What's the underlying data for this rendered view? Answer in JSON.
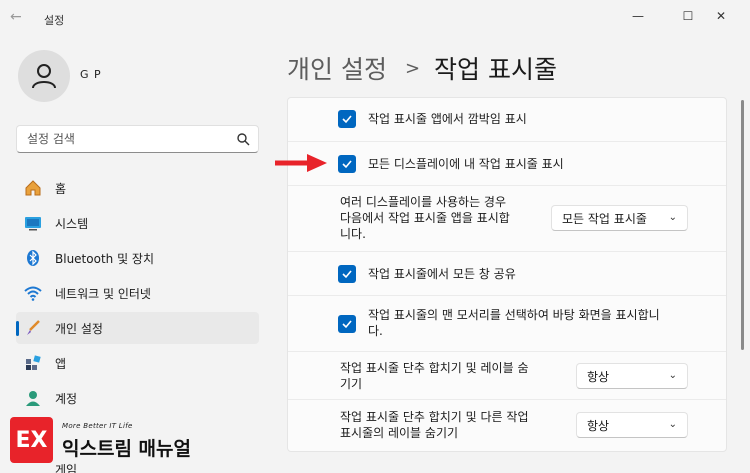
{
  "window": {
    "title": "설정",
    "back": "←",
    "minimize": "—",
    "maximize": "☐",
    "close": "✕"
  },
  "profile": {
    "name": "G P"
  },
  "search": {
    "placeholder": "설정 검색"
  },
  "nav": {
    "items": [
      {
        "label": "홈",
        "icon": "home-icon"
      },
      {
        "label": "시스템",
        "icon": "system-icon"
      },
      {
        "label": "Bluetooth 및 장치",
        "icon": "bluetooth-icon"
      },
      {
        "label": "네트워크 및 인터넷",
        "icon": "wifi-icon"
      },
      {
        "label": "개인 설정",
        "icon": "brush-icon",
        "selected": true
      },
      {
        "label": "앱",
        "icon": "apps-icon"
      },
      {
        "label": "계정",
        "icon": "account-icon"
      }
    ],
    "partial_item": "게임"
  },
  "breadcrumb": {
    "parent": "개인 설정",
    "separator": ">",
    "current": "작업 표시줄"
  },
  "settings": {
    "flash_apps": {
      "label": "작업 표시줄 앱에서 깜박임 표시",
      "checked": true
    },
    "all_displays": {
      "label": "모든 디스플레이에 내 작업 표시줄 표시",
      "checked": true
    },
    "multi_display": {
      "label_line1": "여러 디스플레이를 사용하는 경우",
      "label_line2": "다음에서 작업 표시줄 앱을 표시합",
      "label_line3": "니다.",
      "value": "모든 작업 표시줄"
    },
    "share_windows": {
      "label": "작업 표시줄에서 모든 창 공유",
      "checked": true
    },
    "corner_desktop": {
      "label_line1": "작업 표시줄의 맨 모서리를 선택하여 바탕 화면을 표시합니",
      "label_line2": "다.",
      "checked": true
    },
    "combine_main": {
      "label_line1": "작업 표시줄 단추 합치기 및 레이블 숨",
      "label_line2": "기기",
      "value": "항상"
    },
    "combine_other": {
      "label_line1": "작업 표시줄 단추 합치기 및 다른 작업",
      "label_line2": "표시줄의 레이블 숨기기",
      "value": "항상"
    }
  },
  "watermark": {
    "badge": "EX",
    "tagline": "More Better IT Life",
    "name": "익스트림 매뉴얼"
  },
  "colors": {
    "accent": "#0067c0",
    "arrow": "#e8232a"
  }
}
